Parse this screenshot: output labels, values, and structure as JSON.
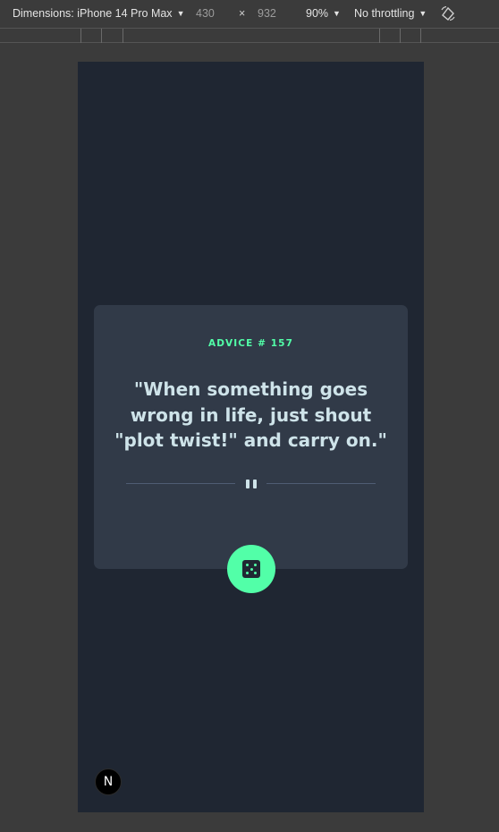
{
  "toolbar": {
    "dimensions_label": "Dimensions: iPhone 14 Pro Max",
    "width": "430",
    "separator": "×",
    "height": "932",
    "zoom": "90%",
    "throttling": "No throttling",
    "dropdown_icon": "caret-down-icon",
    "rotate_icon": "rotate-icon"
  },
  "app": {
    "advice_id_label": "ADVICE # 157",
    "quote": "\"When something goes wrong in life, just shout \"plot twist!\" and carry on.\"",
    "divider_icon": "pause-icon",
    "dice_button_icon": "dice-icon",
    "nextjs_badge": "N"
  },
  "colors": {
    "page_bg": "#1f2632",
    "card_bg": "#313a48",
    "accent": "#52ffa8",
    "quote_text": "#cee3e9",
    "divider": "#4f5d74"
  }
}
